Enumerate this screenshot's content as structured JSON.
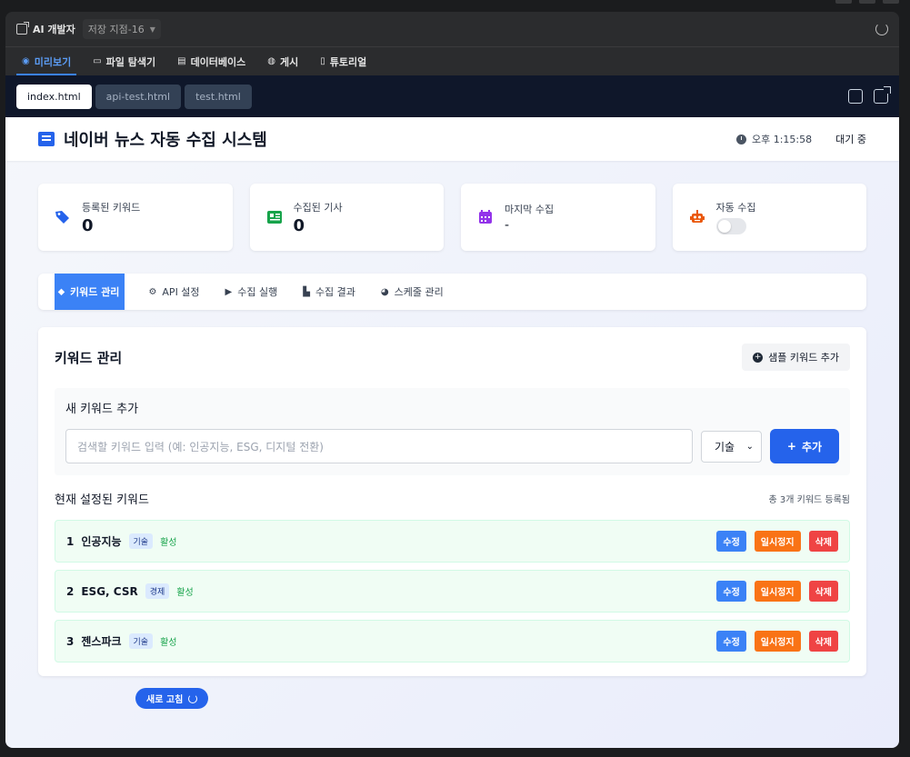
{
  "titlebar": {
    "app_title": "AI 개발자",
    "checkpoint": "저장 지점-16"
  },
  "navtabs": [
    {
      "label": "미리보기",
      "icon": "eye-icon"
    },
    {
      "label": "파일 탐색기",
      "icon": "folder-icon"
    },
    {
      "label": "데이터베이스",
      "icon": "database-icon"
    },
    {
      "label": "게시",
      "icon": "globe-icon"
    },
    {
      "label": "튜토리얼",
      "icon": "help-icon"
    }
  ],
  "filetabs": [
    "index.html",
    "api-test.html",
    "test.html"
  ],
  "header": {
    "title": "네이버 뉴스 자동 수집 시스템",
    "time": "오후 1:15:58",
    "status": "대기 중"
  },
  "stats": [
    {
      "label": "등록된 키워드",
      "value": "0",
      "icon": "tags-icon",
      "color": "#2563eb"
    },
    {
      "label": "수집된 기사",
      "value": "0",
      "icon": "newspaper-icon",
      "color": "#16a34a"
    },
    {
      "label": "마지막 수집",
      "value": "-",
      "icon": "calendar-icon",
      "color": "#9333ea"
    },
    {
      "label": "자동 수집",
      "value": "",
      "icon": "robot-icon",
      "color": "#ea580c"
    }
  ],
  "sectabs": [
    "키워드 관리",
    "API 설정",
    "수집 실행",
    "수집 결과",
    "스케줄 관리"
  ],
  "panel": {
    "title": "키워드 관리",
    "sample_btn": "샘플 키워드 추가",
    "add_title": "새 키워드 추가",
    "input_placeholder": "검색할 키워드 입력 (예: 인공지능, ESG, 디지털 전환)",
    "select_value": "기술",
    "add_btn": "추가",
    "list_title": "현재 설정된 키워드",
    "list_count": "총 3개 키워드 등록됨",
    "keywords": [
      {
        "num": "1",
        "name": "인공지능",
        "category": "기술",
        "state": "활성"
      },
      {
        "num": "2",
        "name": "ESG, CSR",
        "category": "경제",
        "state": "활성"
      },
      {
        "num": "3",
        "name": "젠스파크",
        "category": "기술",
        "state": "활성"
      }
    ],
    "actions": {
      "edit": "수정",
      "pause": "일시정지",
      "delete": "삭제"
    }
  },
  "refresh_btn": "새로 고침"
}
